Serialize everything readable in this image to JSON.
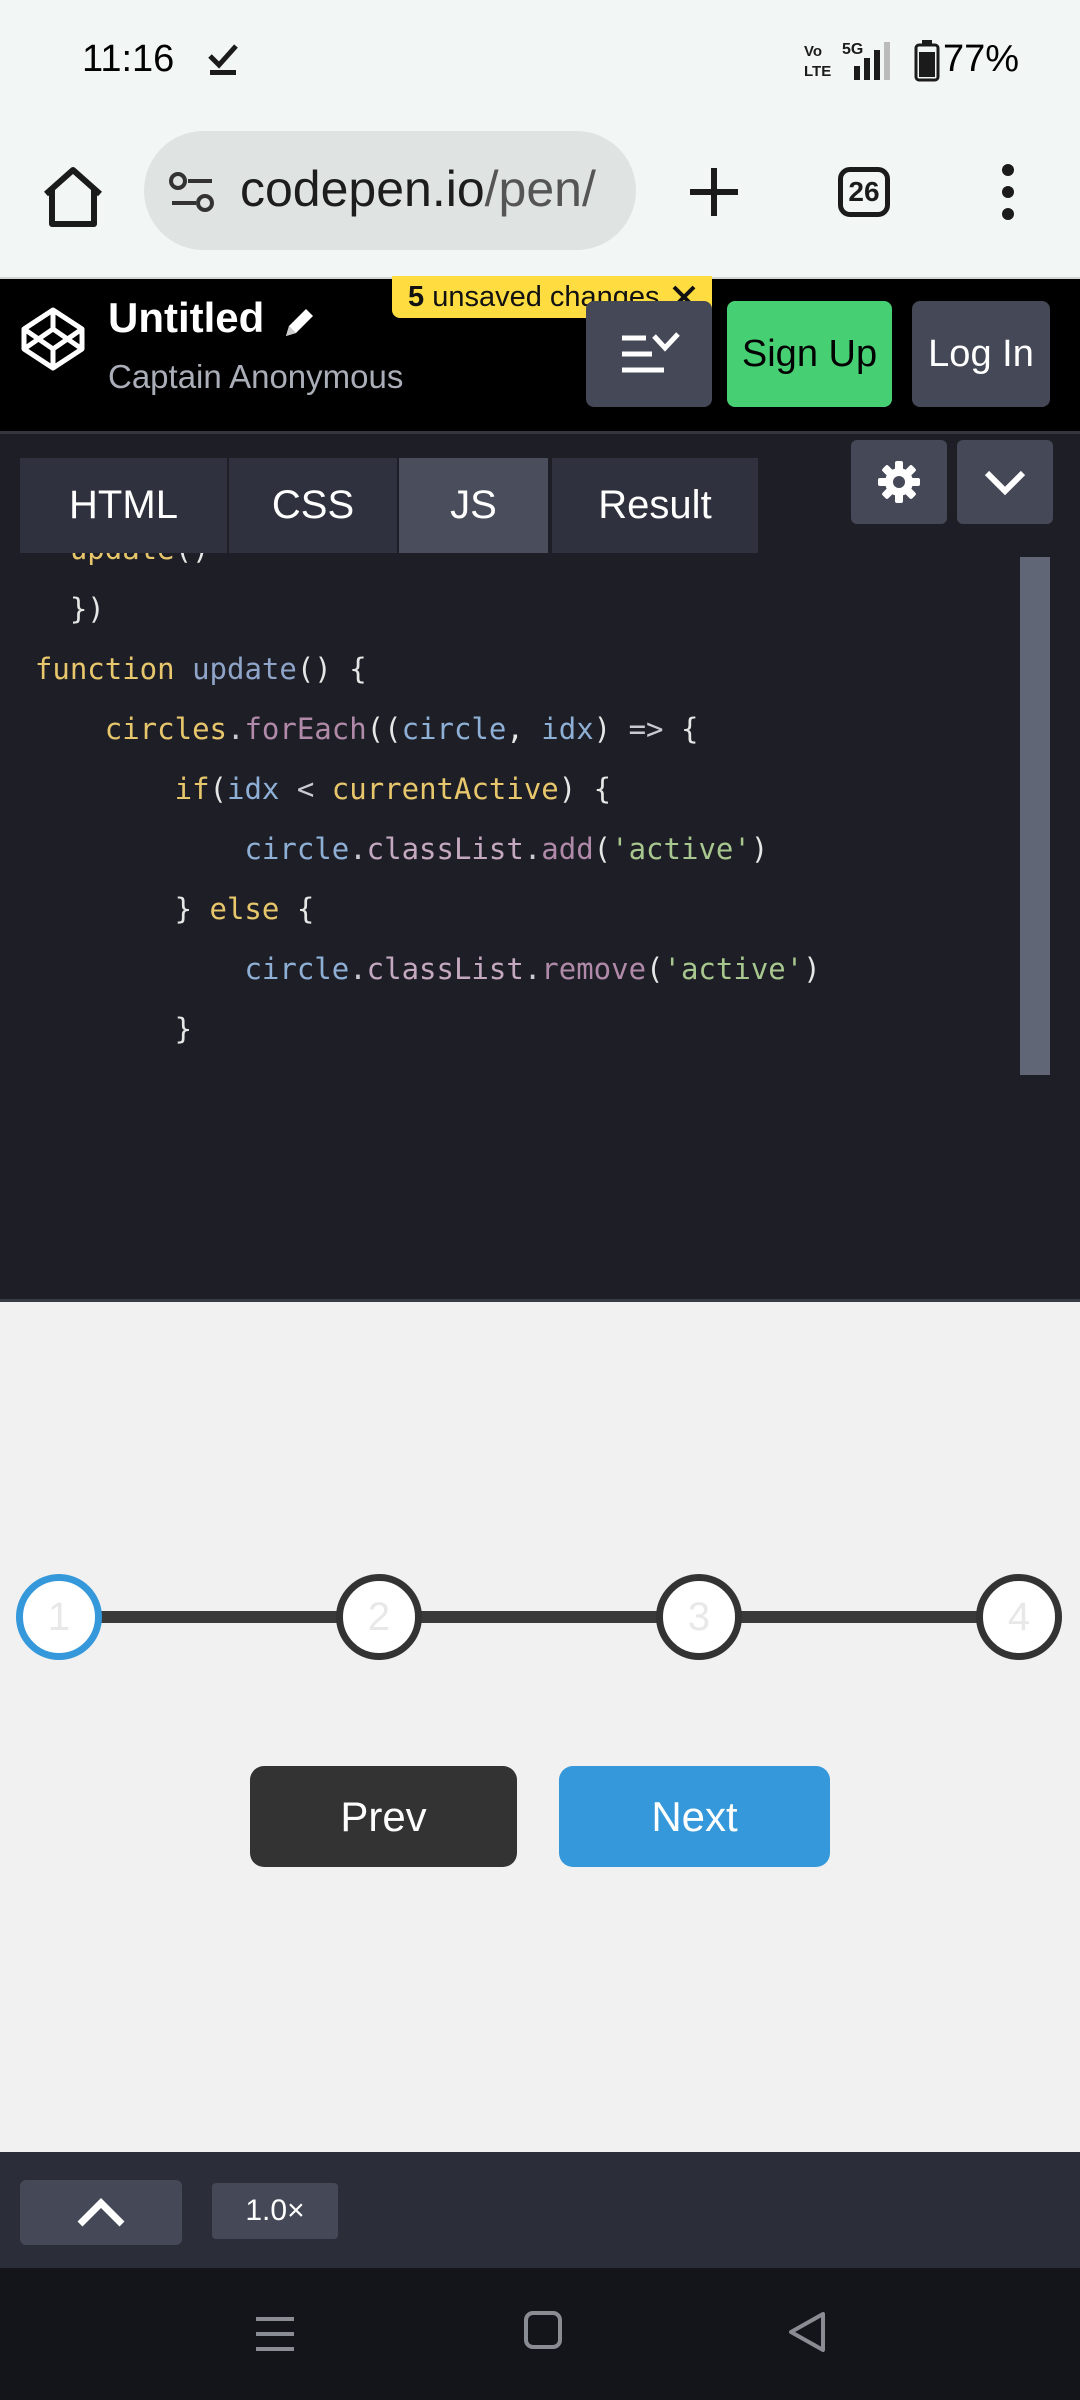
{
  "status_bar": {
    "time": "11:16",
    "battery": "77%",
    "network_label": "5G",
    "volte_label": "Vo LTE"
  },
  "browser": {
    "url_domain": "codepen.io",
    "url_path": "/pen/",
    "tab_count": "26"
  },
  "codepen": {
    "title": "Untitled",
    "author": "Captain Anonymous",
    "unsaved_count": "5",
    "unsaved_text": " unsaved changes",
    "signup_label": "Sign Up",
    "login_label": "Log In",
    "tabs": [
      "HTML",
      "CSS",
      "JS",
      "Result"
    ],
    "active_tab": "JS"
  },
  "code_lines": [
    "    update()",
    "})",
    "function update() {",
    "    circles.forEach((circle, idx) => {",
    "        if(idx < currentActive) {",
    "            circle.classList.add('active')",
    "        } else {",
    "            circle.classList.remove('active')",
    "        }"
  ],
  "result": {
    "steps": [
      "1",
      "2",
      "3",
      "4"
    ],
    "current_active": 1,
    "prev_label": "Prev",
    "next_label": "Next",
    "accent_color": "#3498db",
    "step_border_color": "#333333"
  },
  "footer": {
    "zoom": "1.0×"
  }
}
